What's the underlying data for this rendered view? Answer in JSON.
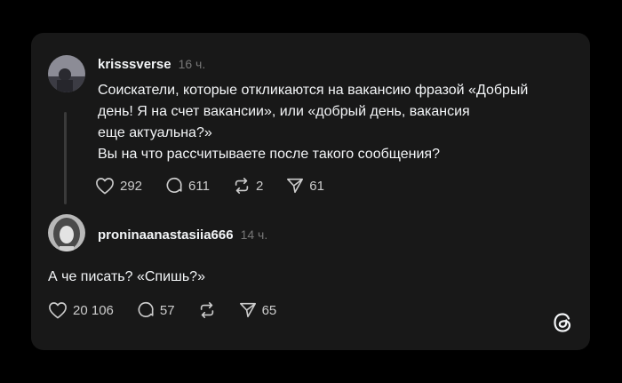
{
  "post": {
    "username": "krisssverse",
    "time": "16 ч.",
    "lines": [
      "Соискатели, которые откликаются на вакансию фразой «Добрый",
      "день! Я на счет вакансии», или «добрый день, вакансия",
      "еще актуальна?»",
      "Вы на что рассчитываете после такого сообщения?"
    ],
    "likes": "292",
    "comments": "611",
    "reposts": "2",
    "shares": "61"
  },
  "reply": {
    "username": "proninaanastasiia666",
    "time": "14 ч.",
    "text": "А че писать? «Спишь?»",
    "likes": "20 106",
    "comments": "57",
    "shares": "65"
  },
  "icons": {
    "like": "heart-icon",
    "comment": "comment-bubble-icon",
    "repost": "repost-icon",
    "share": "send-icon",
    "logo": "threads-logo"
  },
  "colors": {
    "background": "#000000",
    "card": "#181818",
    "text": "#f3f5f7",
    "muted": "#777777"
  }
}
